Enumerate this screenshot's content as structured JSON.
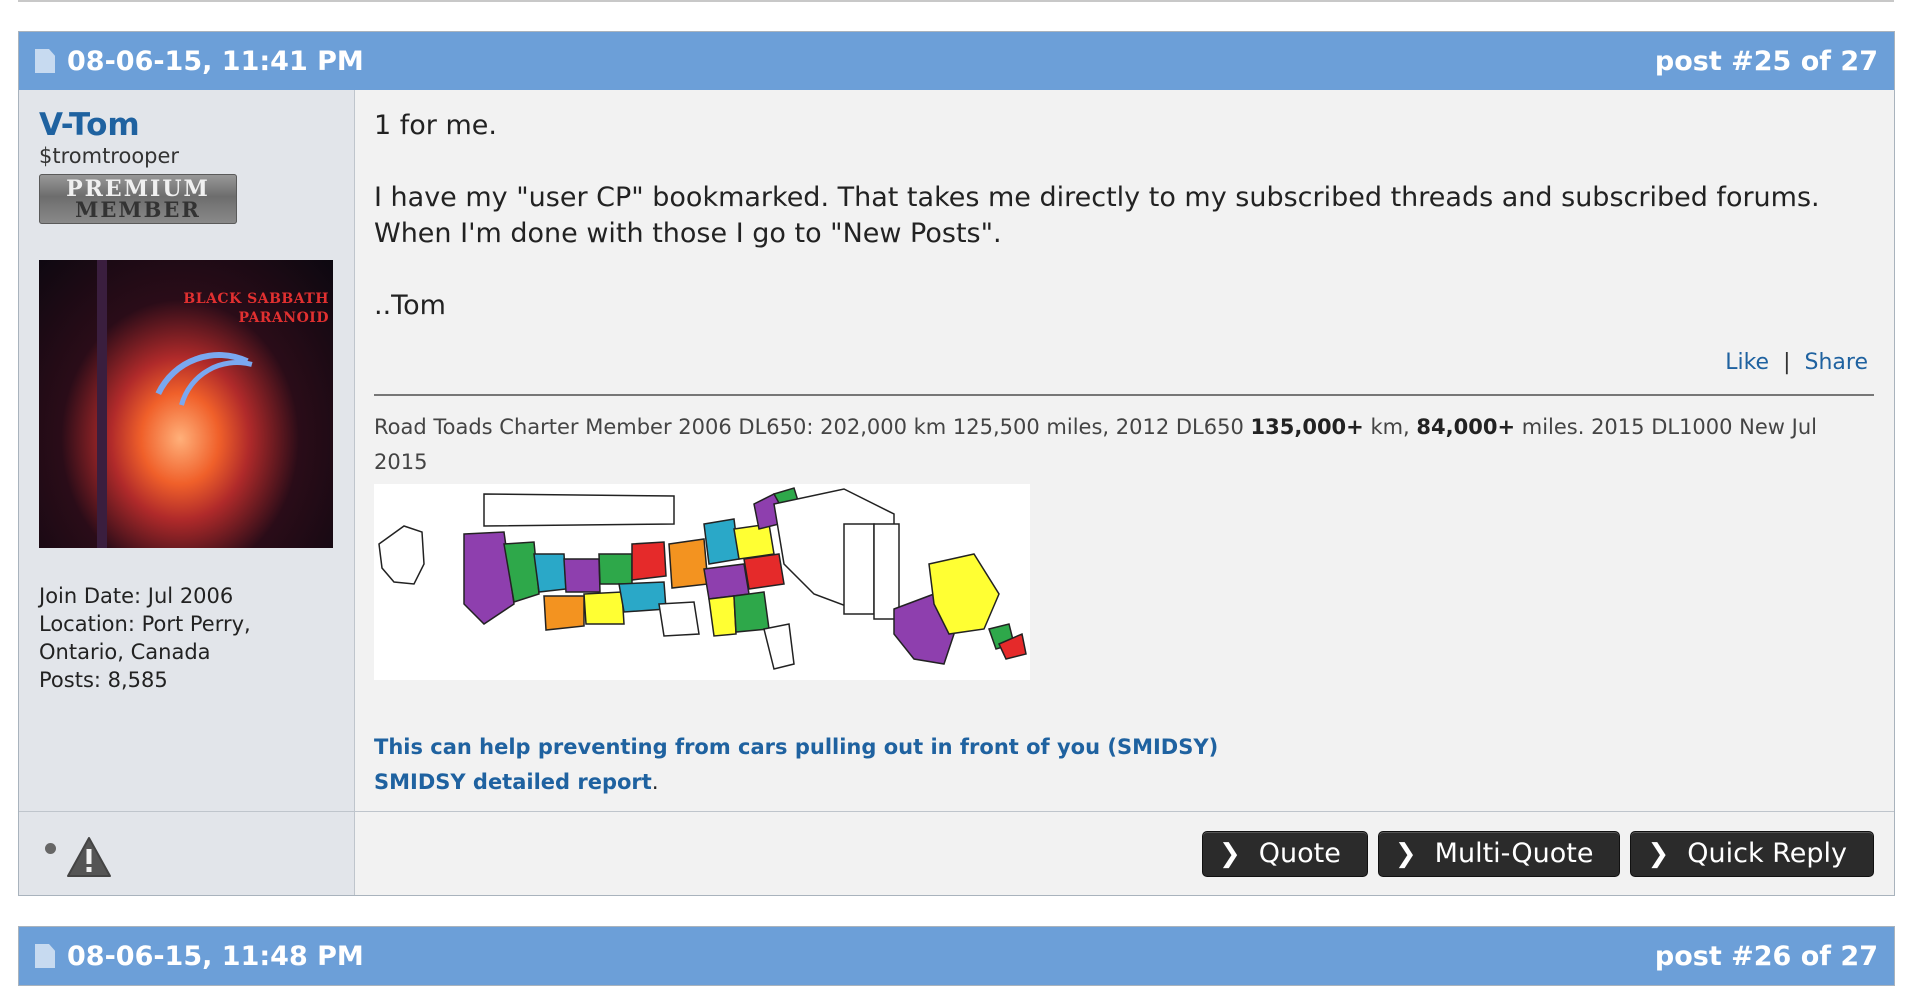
{
  "post": {
    "date": "08-06-15, 11:41 PM",
    "post_number": "post #25 of 27",
    "user": {
      "name": "V-Tom",
      "title": "$tromtrooper",
      "rank_line1": "PREMIUM",
      "rank_line2": "MEMBER",
      "avatar_text_line1": "BLACK SABBATH",
      "avatar_text_line2": "PARANOID",
      "join_date": "Join Date: Jul 2006",
      "location_line1": "Location: Port Perry,",
      "location_line2": "Ontario, Canada",
      "posts": "Posts: 8,585"
    },
    "message": {
      "line1": "1 for me.",
      "line2": "I have my \"user CP\" bookmarked. That takes me directly to my subscribed threads and subscribed forums.",
      "line3": "When I'm done with those I go to \"New Posts\".",
      "line4": "..Tom"
    },
    "actions": {
      "like": "Like",
      "separator": "|",
      "share": "Share"
    },
    "signature": {
      "text_a": "Road Toads Charter Member 2006 DL650: 202,000 km 125,500 miles, 2012 DL650 ",
      "bold_km": "135,000+",
      "text_b": " km, ",
      "bold_miles": "84,000+",
      "text_c": " miles. 2015 DL1000 New Jul 2015",
      "link1": "This can help preventing from cars pulling out in front of you (SMIDSY)",
      "link2": "SMIDSY detailed report",
      "link2_suffix": "."
    },
    "buttons": {
      "quote": "Quote",
      "multi_quote": "Multi-Quote",
      "quick_reply": "Quick Reply"
    }
  },
  "next_post": {
    "date": "08-06-15, 11:48 PM",
    "post_number": "post #26 of 27"
  },
  "colors": {
    "header": "#6c9fd8",
    "link": "#1f62a0",
    "button": "#2b2b2b"
  },
  "icons": {
    "post_icon": "document-icon",
    "report": "warning-icon",
    "online_status": "status-dot-icon",
    "button_chevron": "chevron-right-icon"
  }
}
